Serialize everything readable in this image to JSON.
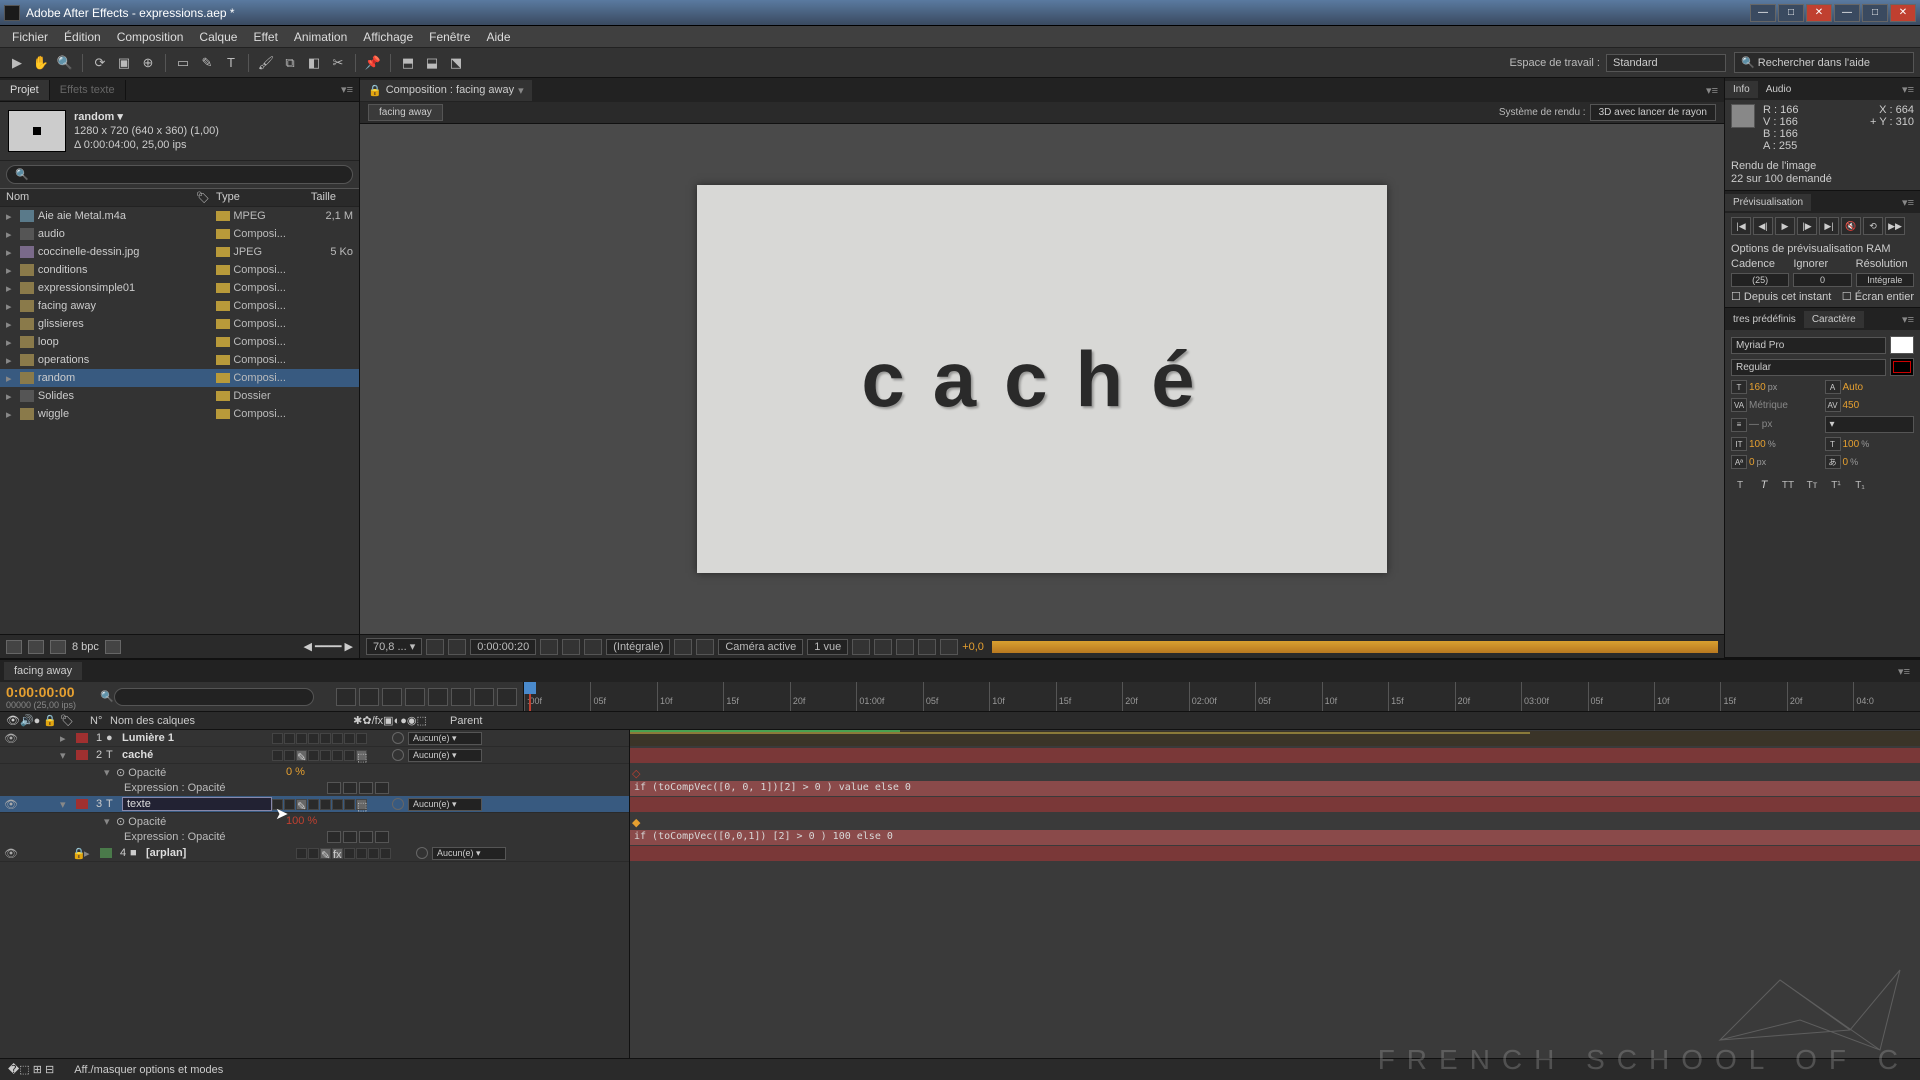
{
  "app": {
    "title": "Adobe After Effects - expressions.aep *"
  },
  "menu": [
    "Fichier",
    "Édition",
    "Composition",
    "Calque",
    "Effet",
    "Animation",
    "Affichage",
    "Fenêtre",
    "Aide"
  ],
  "workspace": {
    "label": "Espace de travail :",
    "value": "Standard"
  },
  "search_help": {
    "placeholder": "Rechercher dans l'aide"
  },
  "project": {
    "tab_active": "Projet",
    "tab_dim": "Effets texte",
    "item_name": "random ▾",
    "meta1": "1280 x 720  (640 x 360) (1,00)",
    "meta2": "Δ 0:00:04:00, 25,00 ips",
    "cols": {
      "name": "Nom",
      "type": "Type",
      "size": "Taille"
    },
    "items": [
      {
        "icon": "mov",
        "name": "Aie aie Metal.m4a",
        "type": "MPEG",
        "size": "2,1 M"
      },
      {
        "icon": "folder",
        "name": "audio",
        "type": "Composi...",
        "size": ""
      },
      {
        "icon": "img",
        "name": "coccinelle-dessin.jpg",
        "type": "JPEG",
        "size": "5 Ko"
      },
      {
        "icon": "comp",
        "name": "conditions",
        "type": "Composi...",
        "size": ""
      },
      {
        "icon": "comp",
        "name": "expressionsimple01",
        "type": "Composi...",
        "size": ""
      },
      {
        "icon": "comp",
        "name": "facing away",
        "type": "Composi...",
        "size": ""
      },
      {
        "icon": "comp",
        "name": "glissieres",
        "type": "Composi...",
        "size": ""
      },
      {
        "icon": "comp",
        "name": "loop",
        "type": "Composi...",
        "size": ""
      },
      {
        "icon": "comp",
        "name": "operations",
        "type": "Composi...",
        "size": ""
      },
      {
        "icon": "comp",
        "name": "random",
        "type": "Composi...",
        "size": "",
        "sel": true
      },
      {
        "icon": "folder",
        "name": "Solides",
        "type": "Dossier",
        "size": ""
      },
      {
        "icon": "comp",
        "name": "wiggle",
        "type": "Composi...",
        "size": ""
      }
    ],
    "footer_bpc": "8 bpc"
  },
  "comp": {
    "tab": "Composition : facing away",
    "sub_tab": "facing away",
    "render_label": "Système de rendu :",
    "render_value": "3D avec lancer de rayon",
    "canvas_text": "caché",
    "footer": {
      "zoom": "70,8 ... ▾",
      "time": "0:00:00:20",
      "res": "(Intégrale)",
      "cam": "Caméra active",
      "view": "1 vue",
      "exp": "+0,0"
    }
  },
  "info": {
    "tab1": "Info",
    "tab2": "Audio",
    "R": "R : 166",
    "G": "V : 166",
    "B": "B : 166",
    "A": "A : 255",
    "X": "X : 664",
    "Y": "+  Y : 310",
    "render1": "Rendu de l'image",
    "render2": "22 sur 100 demandé"
  },
  "preview": {
    "tab": "Prévisualisation",
    "opts_title": "Options de prévisualisation RAM",
    "hdr": {
      "cadence": "Cadence",
      "ignorer": "Ignorer",
      "res": "Résolution"
    },
    "vals": {
      "cadence": "(25)",
      "ignorer": "0",
      "res": "Intégrale"
    },
    "from": "Depuis cet instant",
    "full": "Écran entier"
  },
  "char": {
    "tab1": "tres prédéfinis",
    "tab2": "Caractère",
    "font": "Myriad Pro",
    "style": "Regular",
    "size": "160",
    "size_u": "px",
    "lead": "Auto",
    "kern": "Métrique",
    "track": "450",
    "vscale": "100",
    "vscale_u": "%",
    "hscale": "100",
    "hscale_u": "%",
    "baseline": "0",
    "baseline_u": "px",
    "tsume": "0",
    "tsume_u": "%",
    "px_u": "— px"
  },
  "timeline": {
    "tab": "facing away",
    "timecode": "0:00:00:00",
    "fps": "00000 (25,00 ips)",
    "ruler": [
      ":00f",
      "05f",
      "10f",
      "15f",
      "20f",
      "01:00f",
      "05f",
      "10f",
      "15f",
      "20f",
      "02:00f",
      "05f",
      "10f",
      "15f",
      "20f",
      "03:00f",
      "05f",
      "10f",
      "15f",
      "20f",
      "04:0"
    ],
    "cols": {
      "num": "N°",
      "name": "Nom des calques",
      "parent": "Parent"
    },
    "parent_none": "Aucun(e)  ▾",
    "layers": [
      {
        "n": "1",
        "col": "red",
        "icon": "●",
        "name": "Lumière 1",
        "bold": true
      },
      {
        "n": "2",
        "col": "red",
        "icon": "T",
        "name": "caché",
        "bold": true
      },
      {
        "n": "3",
        "col": "red",
        "icon": "T",
        "name": "texte",
        "bold": false,
        "sel": true
      },
      {
        "n": "4",
        "col": "grn",
        "icon": "■",
        "name": "[arplan]",
        "bold": true
      }
    ],
    "prop_opacity": "Opacité",
    "prop_expr": "Expression : Opacité",
    "val_0": "0 %",
    "val_100": "100 %",
    "expr1": "if (toCompVec([0, 0, 1])[2] > 0 ) value else 0",
    "expr2": "if (toCompVec([0,0,1]) [2] > 0 ) 100 else 0",
    "footer_hint": "Aff./masquer options et modes"
  },
  "watermark": "FRENCH SCHOOL OF C"
}
